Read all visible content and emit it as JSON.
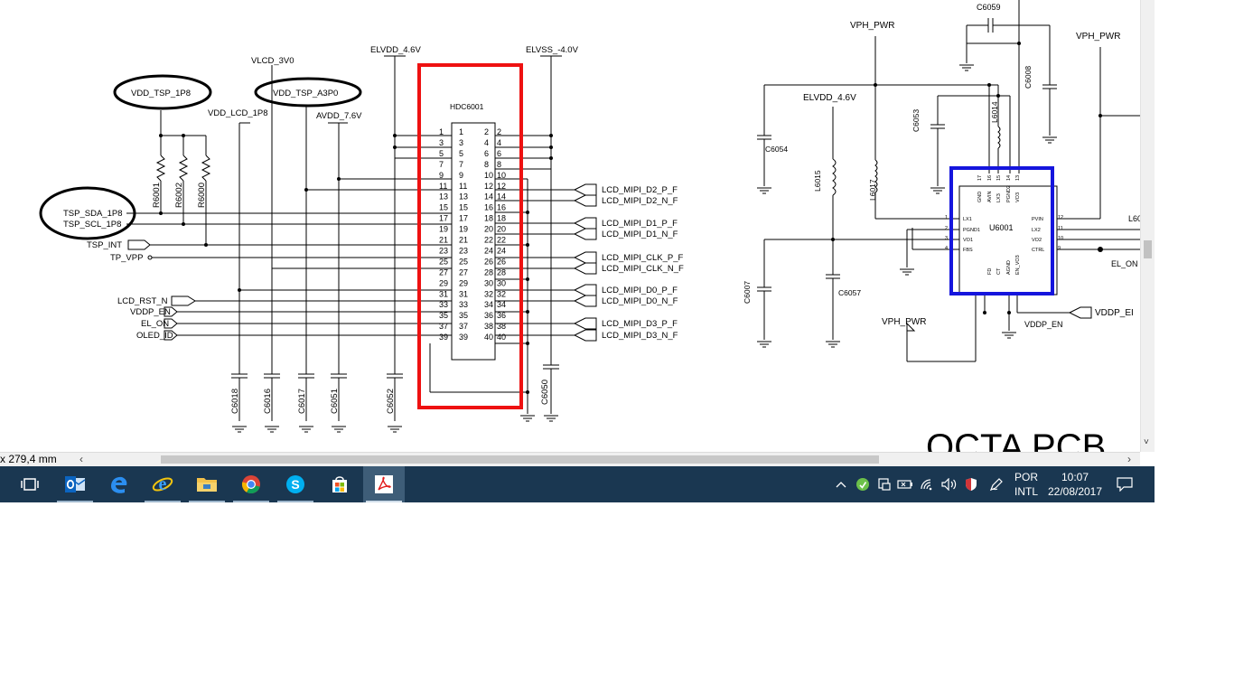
{
  "viewer": {
    "page_size_label": "x 279,4 mm",
    "scroll_left_arrow": "‹",
    "scroll_right_arrow": "›",
    "scroll_down_arrow": "˅"
  },
  "schematic": {
    "left": {
      "rail_vdd_tsp": "VDD_TSP_1P8",
      "rail_vdd_tsp_a3": "VDD_TSP_A3P0",
      "rail_vlcd": "VLCD_3V0",
      "rail_vdd_lcd": "VDD_LCD_1P8",
      "rail_avdd": "AVDD_7.6V",
      "rail_elvdd": "ELVDD_4.6V",
      "rail_elvss": "ELVSS_-4.0V",
      "connector_ref": "HDC6001",
      "resistors": [
        "R6001",
        "R6002",
        "R6000"
      ],
      "left_signals": {
        "tsp_sda": "TSP_SDA_1P8",
        "tsp_scl": "TSP_SCL_1P8",
        "tsp_int": "TSP_INT",
        "tp_vpp": "TP_VPP",
        "lcd_rst": "LCD_RST_N",
        "vddp_en": "VDDP_EN",
        "el_on": "EL_ON",
        "oled_id": "OLED_ID"
      },
      "right_signals": [
        "LCD_MIPI_D2_P_F",
        "LCD_MIPI_D2_N_F",
        "LCD_MIPI_D1_P_F",
        "LCD_MIPI_D1_N_F",
        "LCD_MIPI_CLK_P_F",
        "LCD_MIPI_CLK_N_F",
        "LCD_MIPI_D0_P_F",
        "LCD_MIPI_D0_N_F",
        "LCD_MIPI_D3_P_F",
        "LCD_MIPI_D3_N_F"
      ],
      "bottom_caps": [
        "C6018",
        "C6016",
        "C6017",
        "C6051",
        "C6052",
        "C6050"
      ],
      "pins_odd": [
        "1",
        "3",
        "5",
        "7",
        "9",
        "11",
        "13",
        "15",
        "17",
        "19",
        "21",
        "23",
        "25",
        "27",
        "29",
        "31",
        "33",
        "35",
        "37",
        "39"
      ],
      "pins_even": [
        "2",
        "4",
        "6",
        "8",
        "10",
        "12",
        "14",
        "16",
        "18",
        "20",
        "22",
        "24",
        "26",
        "28",
        "30",
        "32",
        "34",
        "36",
        "38",
        "40"
      ]
    },
    "right": {
      "cap_top": "C6059",
      "rail_vph_pwr": "VPH_PWR",
      "rail_vph_pwr_right": "VPH_PWR",
      "rail_vph_pwr_bottom": "VPH_PWR",
      "rail_elvdd": "ELVDD_4.6V",
      "cap_c6008": "C6008",
      "cap_c6053": "C6053",
      "cap_c6054": "C6054",
      "cap_c6007": "C6007",
      "cap_c6057": "C6057",
      "ind_l6014": "L6014",
      "ind_l6015": "L6015",
      "ind_l6017": "L6017",
      "ind_l60_partial": "L60",
      "ic_ref": "U6001",
      "ic_pins_left": [
        "LX1",
        "PGND1",
        "VO1",
        "FBS"
      ],
      "ic_pins_right": [
        "PVIN",
        "LX2",
        "VO2",
        "CTRL"
      ],
      "ic_pin_nums_left": [
        "1",
        "2",
        "3",
        "4"
      ],
      "ic_pin_nums_right": [
        "12",
        "11",
        "10",
        "9"
      ],
      "ic_pins_top": [
        "GND",
        "AVIN",
        "LX3",
        "PGND2",
        "VO3"
      ],
      "ic_pin_nums_top": [
        "17",
        "16",
        "15",
        "14",
        "13"
      ],
      "ic_pins_bottom": [
        "FD",
        "CT",
        "AGND",
        "EN_VO3"
      ],
      "vddp_en": "VDDP_EN",
      "vddp_en_partial": "VDDP_EI",
      "el_on": "EL_ON",
      "title_partial": "OCTA PCB"
    },
    "highlight_colors": {
      "red_box": "#ee1111",
      "blue_box": "#1515dd"
    }
  },
  "taskbar": {
    "background": "#1a3751",
    "apps": [
      {
        "id": "task-view",
        "icon": "task-view-icon"
      },
      {
        "id": "outlook",
        "icon": "outlook-icon"
      },
      {
        "id": "edge",
        "icon": "edge-icon"
      },
      {
        "id": "internet-explorer",
        "icon": "internet-explorer-icon"
      },
      {
        "id": "file-explorer",
        "icon": "folder-icon"
      },
      {
        "id": "chrome",
        "icon": "chrome-icon"
      },
      {
        "id": "skype",
        "icon": "skype-icon"
      },
      {
        "id": "store",
        "icon": "store-icon"
      },
      {
        "id": "acrobat",
        "icon": "acrobat-icon",
        "active": true
      }
    ],
    "tray": {
      "language_line1": "POR",
      "language_line2": "INTL",
      "time": "10:07",
      "date": "22/08/2017"
    }
  }
}
